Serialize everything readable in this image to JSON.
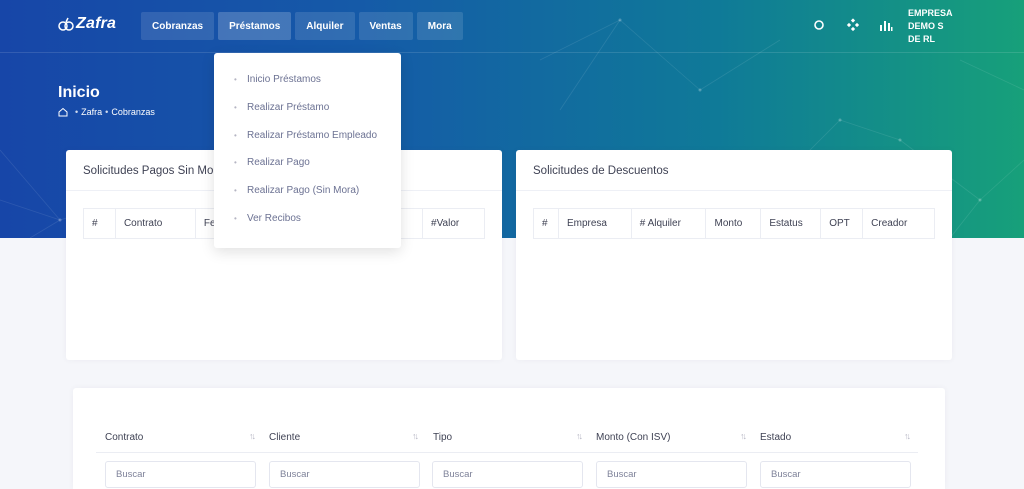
{
  "brand": {
    "name": "Zafra"
  },
  "nav": {
    "items": [
      {
        "label": "Cobranzas"
      },
      {
        "label": "Préstamos"
      },
      {
        "label": "Alquiler"
      },
      {
        "label": "Ventas"
      },
      {
        "label": "Mora"
      }
    ]
  },
  "topbar": {
    "company": "EMPRESA DEMO S DE RL",
    "icons": [
      "search-icon",
      "apps-icon",
      "chart-icon"
    ]
  },
  "page": {
    "title": "Inicio",
    "breadcrumb": [
      "Zafra",
      "Cobranzas"
    ]
  },
  "dropdown": {
    "items": [
      "Inicio Préstamos",
      "Realizar Préstamo",
      "Realizar Préstamo Empleado",
      "Realizar Pago",
      "Realizar Pago (Sin Mora)",
      "Ver Recibos"
    ]
  },
  "card_left": {
    "title": "Solicitudes Pagos Sin Mo",
    "columns": [
      "#",
      "Contrato",
      "Fe",
      "#Valor"
    ]
  },
  "card_right": {
    "title": "Solicitudes de Descuentos",
    "columns": [
      "#",
      "Empresa",
      "# Alquiler",
      "Monto",
      "Estatus",
      "OPT",
      "Creador"
    ]
  },
  "filter_table": {
    "columns": [
      "Contrato",
      "Cliente",
      "Tipo",
      "Monto (Con ISV)",
      "Estado"
    ],
    "search_placeholder": "Buscar"
  },
  "colors": {
    "hero_start": "#1746a8",
    "hero_end": "#17a07a",
    "accent": "#3f4254"
  }
}
